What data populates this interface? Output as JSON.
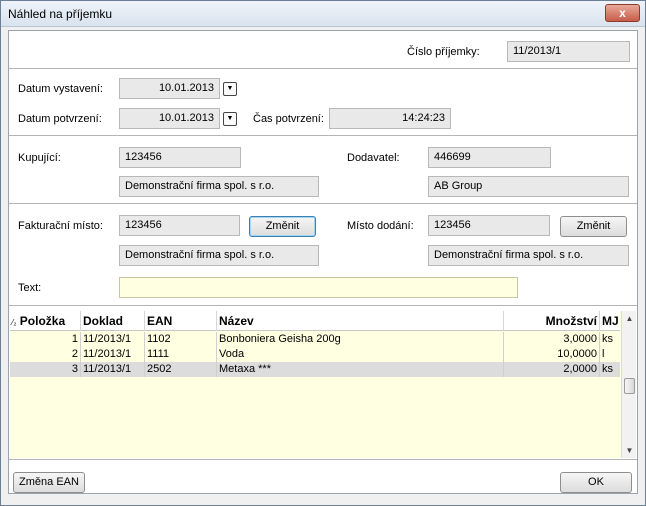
{
  "window": {
    "title": "Náhled na příjemku",
    "close_glyph": "x"
  },
  "header": {
    "receipt_no_label": "Číslo příjemky:",
    "receipt_no": "11/2013/1"
  },
  "dates": {
    "issued_label": "Datum vystavení:",
    "issued": "10.01.2013",
    "confirmed_label": "Datum potvrzení:",
    "confirmed": "10.01.2013",
    "confirm_time_label": "Čas potvrzení:",
    "confirm_time": "14:24:23",
    "dropdown_glyph": "▼"
  },
  "parties": {
    "buyer_label": "Kupující:",
    "buyer_code": "123456",
    "buyer_name": "Demonstrační firma spol. s r.o.",
    "supplier_label": "Dodavatel:",
    "supplier_code": "446699",
    "supplier_name": "AB Group"
  },
  "places": {
    "billing_label": "Fakturační místo:",
    "billing_code": "123456",
    "billing_name": "Demonstrační firma spol. s r.o.",
    "billing_change": "Změnit",
    "delivery_label": "Místo dodání:",
    "delivery_code": "123456",
    "delivery_name": "Demonstrační firma spol. s r.o.",
    "delivery_change": "Změnit"
  },
  "text": {
    "label": "Text:",
    "value": ""
  },
  "grid": {
    "sort_glyph": "⁄₂",
    "columns": [
      "Položka",
      "Doklad",
      "EAN",
      "Název",
      "Množství",
      "MJ"
    ],
    "rows": [
      {
        "polozka": "1",
        "doklad": "11/2013/1",
        "ean": "1102",
        "nazev": "Bonboniera Geisha 200g",
        "mnozstvi": "3,0000",
        "mj": "ks"
      },
      {
        "polozka": "2",
        "doklad": "11/2013/1",
        "ean": "1111",
        "nazev": "Voda",
        "mnozstvi": "10,0000",
        "mj": "l"
      },
      {
        "polozka": "3",
        "doklad": "11/2013/1",
        "ean": "2502",
        "nazev": "Metaxa ***",
        "mnozstvi": "2,0000",
        "mj": "ks"
      }
    ],
    "scroll_up": "▲",
    "scroll_down": "▼"
  },
  "footer": {
    "change_ean": "Změna EAN",
    "ok": "OK"
  }
}
